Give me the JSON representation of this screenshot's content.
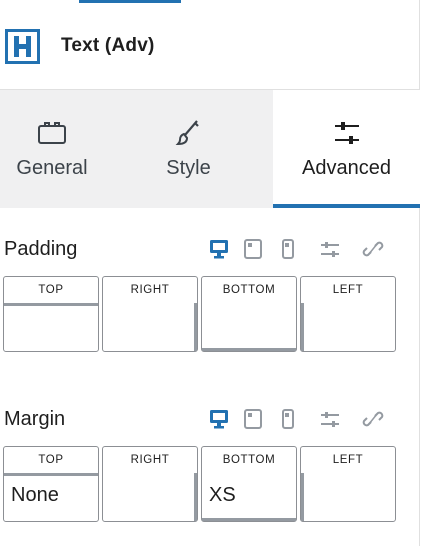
{
  "block": {
    "title": "Text (Adv)",
    "icon": "heading-h-icon"
  },
  "tabs": [
    {
      "label": "General",
      "icon": "suitcase-icon",
      "active": false
    },
    {
      "label": "Style",
      "icon": "paintbrush-icon",
      "active": false
    },
    {
      "label": "Advanced",
      "icon": "sliders-icon",
      "active": true
    }
  ],
  "padding": {
    "label": "Padding",
    "boxes": [
      {
        "label": "TOP",
        "value": ""
      },
      {
        "label": "RIGHT",
        "value": ""
      },
      {
        "label": "BOTTOM",
        "value": ""
      },
      {
        "label": "LEFT",
        "value": ""
      }
    ]
  },
  "margin": {
    "label": "Margin",
    "boxes": [
      {
        "label": "TOP",
        "value": "None"
      },
      {
        "label": "RIGHT",
        "value": ""
      },
      {
        "label": "BOTTOM",
        "value": "XS"
      },
      {
        "label": "LEFT",
        "value": ""
      }
    ]
  },
  "device_icons": [
    "desktop-icon",
    "tablet-icon",
    "mobile-icon",
    "sliders-icon",
    "unlink-icon"
  ],
  "colors": {
    "accent": "#2271b1",
    "tab_bg": "#f0f0f1",
    "border": "#8c8f94"
  }
}
